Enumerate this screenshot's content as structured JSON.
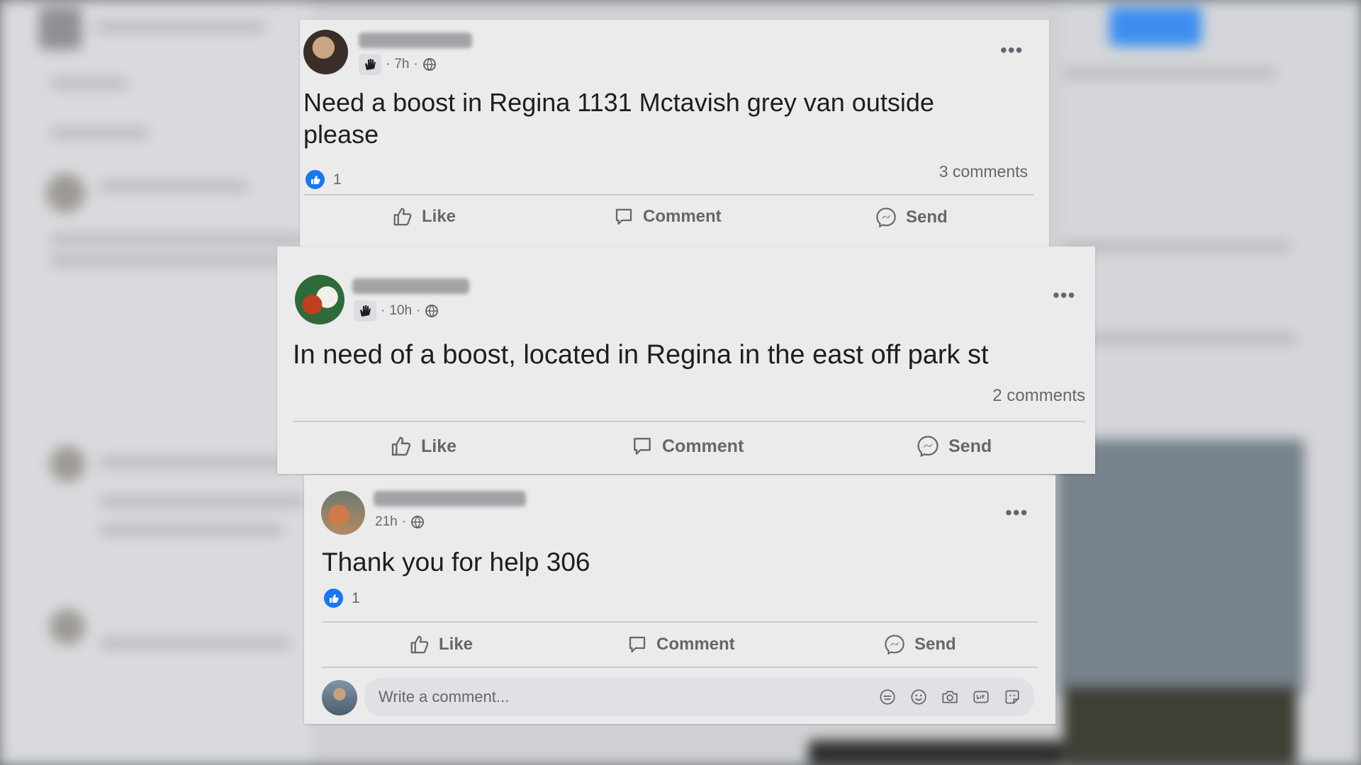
{
  "posts": [
    {
      "time": "7h",
      "text": "Need a boost in Regina 1131 Mctavish grey van outside please",
      "like_count": "1",
      "comments": "3 comments",
      "actions": {
        "like": "Like",
        "comment": "Comment",
        "send": "Send"
      }
    },
    {
      "time": "10h",
      "text": "In need of a boost, located in Regina in the east off park st",
      "comments": "2 comments",
      "actions": {
        "like": "Like",
        "comment": "Comment",
        "send": "Send"
      }
    },
    {
      "time": "21h",
      "text": "Thank you for help 306",
      "like_count": "1",
      "actions": {
        "like": "Like",
        "comment": "Comment",
        "send": "Send"
      },
      "comment_placeholder": "Write a comment..."
    }
  ],
  "meta_separator": "·",
  "more_glyph": "•••",
  "colors": {
    "brand_blue": "#1877f2",
    "card_bg": "#ebebeb",
    "muted_text": "#65676b"
  },
  "icons": [
    "hand-badge-icon",
    "globe-icon",
    "more-options-icon",
    "like-icon",
    "comment-icon",
    "messenger-icon",
    "sticker-icon",
    "emoji-icon",
    "camera-icon",
    "gif-icon",
    "avatar-sticker-icon"
  ]
}
